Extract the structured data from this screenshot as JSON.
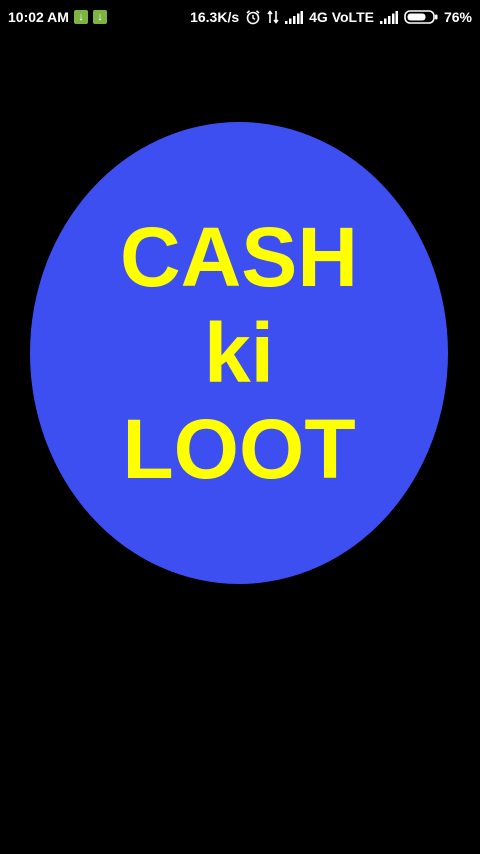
{
  "status_bar": {
    "time": "10:02 AM",
    "network_speed": "16.3K/s",
    "network_type": "4G VoLTE",
    "battery": "76%",
    "icons": [
      "download-icon",
      "download-icon",
      "alarm-icon",
      "data-transfer-icon",
      "signal-icon",
      "signal-icon",
      "battery-icon"
    ]
  },
  "logo": {
    "line1": "CASH",
    "line2": "ki",
    "line3": "LOOT",
    "circle_color": "#3d4ff0",
    "text_color": "#ffff00"
  },
  "background_color": "#000000"
}
